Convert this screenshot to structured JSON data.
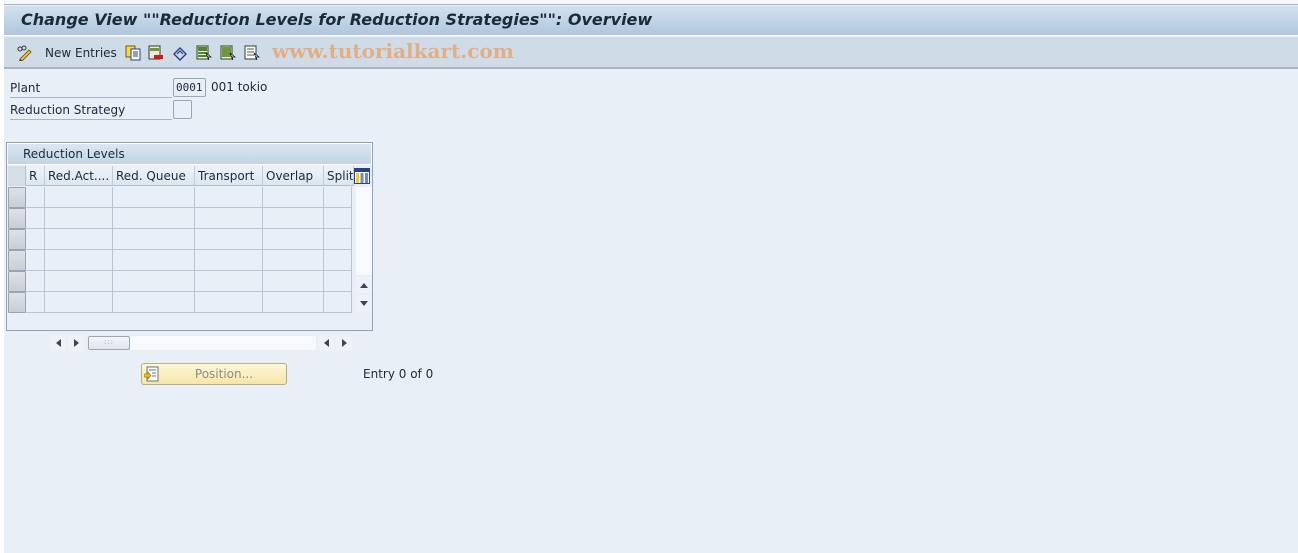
{
  "window": {
    "title": "Change View \"\"Reduction Levels for Reduction Strategies\"\": Overview"
  },
  "toolbar": {
    "items": [
      {
        "name": "display-change-toggle",
        "icon": "pencil-glasses-icon"
      },
      {
        "name": "new-entries",
        "label": "New Entries"
      },
      {
        "name": "copy-as",
        "icon": "copy-icon"
      },
      {
        "name": "delete",
        "icon": "delete-row-icon"
      },
      {
        "name": "undo-change",
        "icon": "undo-icon"
      },
      {
        "name": "select-all",
        "icon": "select-all-icon"
      },
      {
        "name": "select-block",
        "icon": "select-block-icon"
      },
      {
        "name": "deselect-all",
        "icon": "deselect-all-icon"
      }
    ],
    "new_entries_label": "New Entries",
    "watermark": "www.tutorialkart.com"
  },
  "fields": {
    "plant": {
      "label": "Plant",
      "value": "0001",
      "description": "001 tokio"
    },
    "reduction_strategy": {
      "label": "Reduction Strategy",
      "value": ""
    }
  },
  "table": {
    "title": "Reduction Levels",
    "columns": [
      "R",
      "Red.Act....",
      "Red. Queue",
      "Transport",
      "Overlap",
      "Split"
    ],
    "rows": [
      [
        "",
        "",
        "",
        "",
        "",
        ""
      ],
      [
        "",
        "",
        "",
        "",
        "",
        ""
      ],
      [
        "",
        "",
        "",
        "",
        "",
        ""
      ],
      [
        "",
        "",
        "",
        "",
        "",
        ""
      ],
      [
        "",
        "",
        "",
        "",
        "",
        ""
      ],
      [
        "",
        "",
        "",
        "",
        "",
        ""
      ]
    ]
  },
  "footer": {
    "position_button_label": "Position...",
    "entry_info": "Entry 0 of 0"
  },
  "colors": {
    "background": "#e8eff7",
    "title_bar": "#b0c6de",
    "toolbar": "#cfdce7",
    "position_button": "#f6e7a6",
    "watermark": "#e8a064"
  }
}
